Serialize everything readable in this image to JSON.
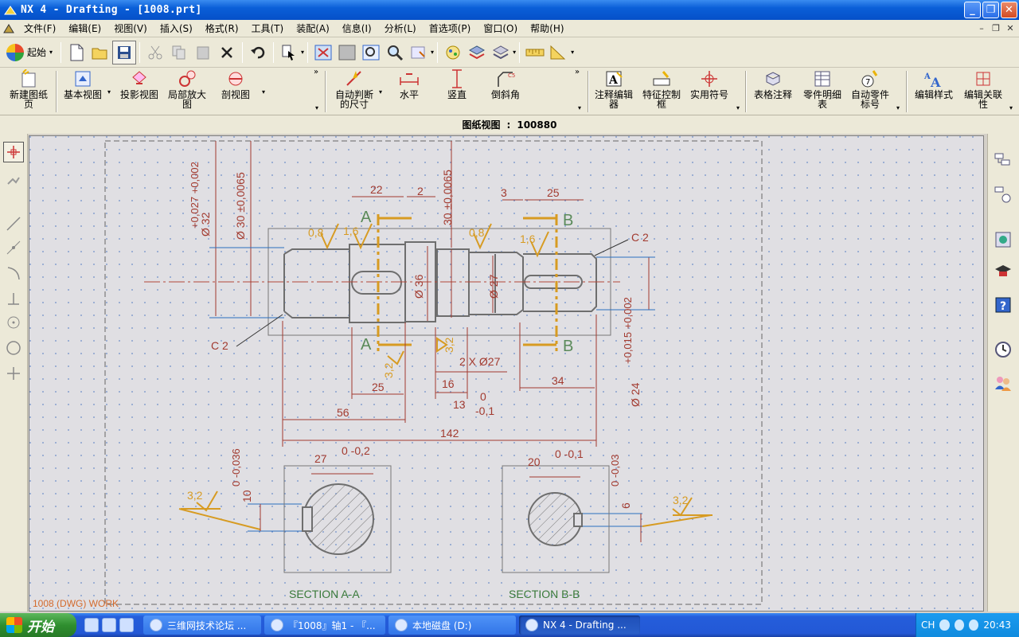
{
  "window": {
    "title": "NX 4 - Drafting - [1008.prt]",
    "buttons": {
      "minimize": "_",
      "maximize": "❐",
      "close": "✕"
    }
  },
  "menubar": {
    "items": [
      "文件(F)",
      "编辑(E)",
      "视图(V)",
      "插入(S)",
      "格式(R)",
      "工具(T)",
      "装配(A)",
      "信息(I)",
      "分析(L)",
      "首选项(P)",
      "窗口(O)",
      "帮助(H)"
    ]
  },
  "toolbar1": {
    "start_label": "起始",
    "tools": [
      "new-icon",
      "open-icon",
      "save-icon",
      "cut-icon",
      "copy-icon",
      "paste-icon",
      "delete-icon",
      "undo-icon",
      "select-icon",
      "fit-icon",
      "refresh-icon",
      "zoom-icon",
      "zoom-in-icon",
      "pan-icon",
      "rotate-icon",
      "layer-icon",
      "display-icon",
      "measure-icon",
      "angle-icon"
    ]
  },
  "toolbar2": {
    "buttons": [
      {
        "name": "new-sheet",
        "label": "新建图纸\n页"
      },
      {
        "name": "base-view",
        "label": "基本视图"
      },
      {
        "name": "projected-view",
        "label": "投影视图"
      },
      {
        "name": "detail-view",
        "label": "局部放大\n图"
      },
      {
        "name": "section-view",
        "label": "剖视图"
      },
      {
        "name": "auto-dim",
        "label": "自动判断\n的尺寸"
      },
      {
        "name": "horizontal",
        "label": "水平"
      },
      {
        "name": "vertical",
        "label": "竖直"
      },
      {
        "name": "chamfer",
        "label": "倒斜角"
      },
      {
        "name": "annotation-editor",
        "label": "注释编辑\n器"
      },
      {
        "name": "feature-control-frame",
        "label": "特征控制\n框"
      },
      {
        "name": "utility-symbol",
        "label": "实用符号"
      },
      {
        "name": "tabular-note",
        "label": "表格注释"
      },
      {
        "name": "parts-list",
        "label": "零件明细\n表"
      },
      {
        "name": "auto-balloon",
        "label": "自动零件\n标号"
      },
      {
        "name": "edit-style",
        "label": "编辑样式"
      },
      {
        "name": "edit-association",
        "label": "编辑关联\n性"
      }
    ]
  },
  "viewbar": {
    "label": "图纸视图",
    "value": "100880"
  },
  "drawing": {
    "work_label": "1008 (DWG) WORK",
    "section_a_label": "SECTION A-A",
    "section_b_label": "SECTION B-B",
    "dims": {
      "d22": "22",
      "d2": "2",
      "d3": "3",
      "d25top": "25",
      "d25bot": "25",
      "d16": "16",
      "d13": "13",
      "d56": "56",
      "d142": "142",
      "d34": "34",
      "tol0": "0",
      "tol01": "-0,1",
      "chamfer_note": "2 X Ø27",
      "d32": "Ø 32",
      "d32tol": "+0,027 +0,002",
      "d30": "Ø 30 ±0,0065",
      "d30b": "30 ±0,0065",
      "d36": "Ø 36",
      "d27": "Ø 27",
      "d24": "Ø 24",
      "d24tol": "+0,015 +0,002",
      "cz": "C 2",
      "ra08": "0,8",
      "ra16": "1,6",
      "ra32": "3,2",
      "sa27": "27",
      "sa_tol": "0 -0,2",
      "sa10": "10",
      "sa10tol": "0 -0,036",
      "sb20": "20",
      "sb_tol": "0 -0,1",
      "sb6": "6",
      "sb6tol": "0 -0,03",
      "A": "A",
      "B": "B"
    }
  },
  "taskbar": {
    "start_label": "开始",
    "tasks": [
      {
        "label": "三维网技术论坛 ...",
        "active": false
      },
      {
        "label": "『1008』轴1 - 『...",
        "active": false
      },
      {
        "label": "本地磁盘 (D:)",
        "active": false
      },
      {
        "label": "NX 4 - Drafting ...",
        "active": true
      }
    ],
    "lang": "CH",
    "clock": "20:43"
  },
  "colors": {
    "titlebar": "#0550c8",
    "chrome": "#ece9d8",
    "canvas": "#e0dfe3",
    "dim_red": "#a23a2f",
    "outline_gray": "#6e6e6e",
    "centerline_orange": "#d79b22",
    "leader_blue": "#2a6fbf"
  }
}
